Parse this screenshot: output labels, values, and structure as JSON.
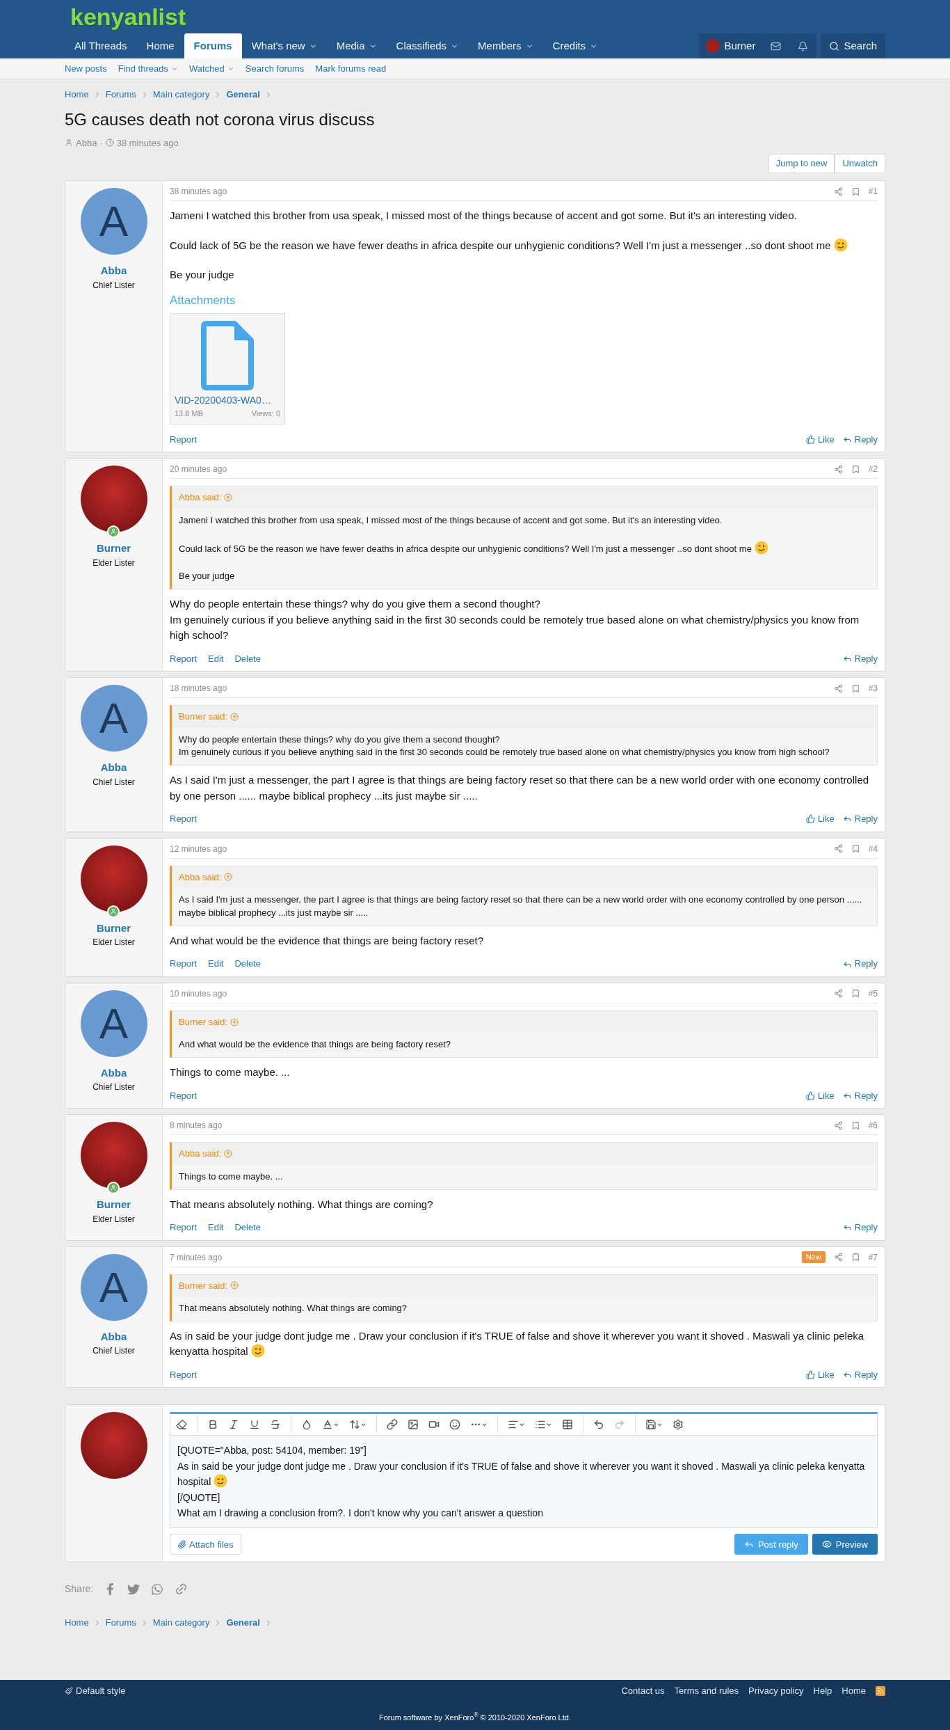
{
  "site": {
    "logo": "kenyanlist"
  },
  "nav": {
    "tabs": [
      {
        "label": "All Threads",
        "selected": false,
        "dropdown": false
      },
      {
        "label": "Home",
        "selected": false,
        "dropdown": false
      },
      {
        "label": "Forums",
        "selected": true,
        "dropdown": false
      },
      {
        "label": "What's new",
        "selected": false,
        "dropdown": true
      },
      {
        "label": "Media",
        "selected": false,
        "dropdown": true
      },
      {
        "label": "Classifieds",
        "selected": false,
        "dropdown": true
      },
      {
        "label": "Members",
        "selected": false,
        "dropdown": true
      },
      {
        "label": "Credits",
        "selected": false,
        "dropdown": true
      }
    ],
    "user": "Burner",
    "search": "Search"
  },
  "subnav": [
    {
      "label": "New posts",
      "dropdown": false
    },
    {
      "label": "Find threads",
      "dropdown": true
    },
    {
      "label": "Watched",
      "dropdown": true
    },
    {
      "label": "Search forums",
      "dropdown": false
    },
    {
      "label": "Mark forums read",
      "dropdown": false
    }
  ],
  "breadcrumb": [
    {
      "label": "Home",
      "current": false
    },
    {
      "label": "Forums",
      "current": false
    },
    {
      "label": "Main category",
      "current": false
    },
    {
      "label": "General",
      "current": true
    }
  ],
  "thread": {
    "title": "5G causes death not corona virus discuss",
    "author": "Abba",
    "separator": "·",
    "time": "38 minutes ago"
  },
  "thread_buttons": [
    "Jump to new",
    "Unwatch"
  ],
  "posts": [
    {
      "time": "38 minutes ago",
      "number": "#1",
      "author": {
        "name": "Abba",
        "title": "Chief Lister",
        "avatar": {
          "kind": "letter",
          "letter": "A"
        }
      },
      "body": {
        "paragraphs": [
          {
            "lines": [
              {
                "text": "Jameni I watched this brother from usa speak, I missed most of the things because of accent and got some. But it's an interesting video.",
                "emoji": false
              }
            ]
          },
          {
            "lines": [
              {
                "text": "Could lack of 5G be the reason we have fewer deaths in africa despite our unhygienic conditions? Well I'm just a messenger ..so dont shoot me",
                "emoji": true
              }
            ]
          },
          {
            "lines": [
              {
                "text": "Be your judge",
                "emoji": false
              }
            ]
          }
        ]
      },
      "attachments_title": "Attachments",
      "attachments": [
        {
          "name": "VID-20200403-WA0…",
          "size": "13.8 MB",
          "views": "Views: 0"
        }
      ],
      "actions": [
        "Report"
      ],
      "like": "Like",
      "reply": "Reply"
    },
    {
      "time": "20 minutes ago",
      "number": "#2",
      "author": {
        "name": "Burner",
        "title": "Elder Lister",
        "avatar": {
          "kind": "photo",
          "online": true
        }
      },
      "quote": {
        "author": "Abba said:",
        "paragraphs": [
          {
            "lines": [
              {
                "text": "Jameni I watched this brother from usa speak, I missed most of the things because of accent and got some. But it's an interesting video.",
                "emoji": false
              }
            ]
          },
          {
            "lines": [
              {
                "text": "Could lack of 5G be the reason we have fewer deaths in africa despite our unhygienic conditions? Well I'm just a messenger ..so dont shoot me",
                "emoji": true
              }
            ]
          },
          {
            "lines": [
              {
                "text": "Be your judge",
                "emoji": false
              }
            ]
          }
        ]
      },
      "body": {
        "paragraphs": [
          {
            "lines": [
              {
                "text": "Why do people entertain these things? why do you give them a second thought?",
                "emoji": false
              },
              {
                "text": "Im genuinely curious if you believe anything said in the first 30 seconds could be remotely true based alone on what chemistry/physics you know from high school?",
                "emoji": false
              }
            ]
          }
        ]
      },
      "actions": [
        "Report",
        "Edit",
        "Delete"
      ],
      "reply": "Reply"
    },
    {
      "time": "18 minutes ago",
      "number": "#3",
      "author": {
        "name": "Abba",
        "title": "Chief Lister",
        "avatar": {
          "kind": "letter",
          "letter": "A"
        }
      },
      "quote": {
        "author": "Burner said:",
        "paragraphs": [
          {
            "lines": [
              {
                "text": "Why do people entertain these things? why do you give them a second thought?",
                "emoji": false
              },
              {
                "text": "Im genuinely curious if you believe anything said in the first 30 seconds could be remotely true based alone on what chemistry/physics you know from high school?",
                "emoji": false
              }
            ]
          }
        ]
      },
      "body": {
        "paragraphs": [
          {
            "lines": [
              {
                "text": "As I said I'm just a messenger, the part I agree is that things are being factory reset so that there can be a new world order with one economy controlled by one person ...... maybe biblical prophecy ...its just maybe sir .....",
                "emoji": false
              }
            ]
          }
        ]
      },
      "actions": [
        "Report"
      ],
      "like": "Like",
      "reply": "Reply"
    },
    {
      "time": "12 minutes ago",
      "number": "#4",
      "author": {
        "name": "Burner",
        "title": "Elder Lister",
        "avatar": {
          "kind": "photo",
          "online": true
        }
      },
      "quote": {
        "author": "Abba said:",
        "paragraphs": [
          {
            "lines": [
              {
                "text": "As I said I'm just a messenger, the part I agree is that things are being factory reset so that there can be a new world order with one economy controlled by one person ...... maybe biblical prophecy ...its just maybe sir .....",
                "emoji": false
              }
            ]
          }
        ]
      },
      "body": {
        "paragraphs": [
          {
            "lines": [
              {
                "text": "And what would be the evidence that things are being factory reset?",
                "emoji": false
              }
            ]
          }
        ]
      },
      "actions": [
        "Report",
        "Edit",
        "Delete"
      ],
      "reply": "Reply"
    },
    {
      "time": "10 minutes ago",
      "number": "#5",
      "author": {
        "name": "Abba",
        "title": "Chief Lister",
        "avatar": {
          "kind": "letter",
          "letter": "A"
        }
      },
      "quote": {
        "author": "Burner said:",
        "paragraphs": [
          {
            "lines": [
              {
                "text": "And what would be the evidence that things are being factory reset?",
                "emoji": false
              }
            ]
          }
        ]
      },
      "body": {
        "paragraphs": [
          {
            "lines": [
              {
                "text": "Things to come maybe. ...",
                "emoji": false
              }
            ]
          }
        ]
      },
      "actions": [
        "Report"
      ],
      "like": "Like",
      "reply": "Reply"
    },
    {
      "time": "8 minutes ago",
      "number": "#6",
      "author": {
        "name": "Burner",
        "title": "Elder Lister",
        "avatar": {
          "kind": "photo",
          "online": true
        }
      },
      "quote": {
        "author": "Abba said:",
        "paragraphs": [
          {
            "lines": [
              {
                "text": "Things to come maybe. ...",
                "emoji": false
              }
            ]
          }
        ]
      },
      "body": {
        "paragraphs": [
          {
            "lines": [
              {
                "text": "That means absolutely nothing. What things are coming?",
                "emoji": false
              }
            ]
          }
        ]
      },
      "actions": [
        "Report",
        "Edit",
        "Delete"
      ],
      "reply": "Reply"
    },
    {
      "time": "7 minutes ago",
      "number": "#7",
      "badge": "New",
      "author": {
        "name": "Abba",
        "title": "Chief Lister",
        "avatar": {
          "kind": "letter",
          "letter": "A"
        }
      },
      "quote": {
        "author": "Burner said:",
        "paragraphs": [
          {
            "lines": [
              {
                "text": "That means absolutely nothing. What things are coming?",
                "emoji": false
              }
            ]
          }
        ]
      },
      "body": {
        "paragraphs": [
          {
            "lines": [
              {
                "text": "As in said be your judge dont judge me . Draw your conclusion if it's TRUE of false and shove it wherever you want it shoved . Maswali ya clinic peleka kenyatta hospital",
                "emoji": true
              }
            ]
          }
        ]
      },
      "actions": [
        "Report"
      ],
      "like": "Like",
      "reply": "Reply"
    }
  ],
  "reply_editor": {
    "lines": [
      {
        "text": "[QUOTE=\"Abba, post: 54104, member: 19\"]",
        "emoji": false
      },
      {
        "text": "As in said be your judge dont judge me . Draw your conclusion if it's TRUE of false and shove it wherever you want it shoved . Maswali ya clinic peleka kenyatta hospital",
        "emoji": true
      },
      {
        "text": "[/QUOTE]",
        "emoji": false
      },
      {
        "text": "What am I drawing a conclusion from?. I don't know why you can't answer a question",
        "emoji": false
      }
    ],
    "attach": "Attach files",
    "buttons": [
      {
        "label": "Post reply",
        "kind": "post"
      },
      {
        "label": "Preview",
        "kind": "preview"
      }
    ]
  },
  "share": "Share:",
  "breadcrumb_bottom": [
    {
      "label": "Home",
      "current": false
    },
    {
      "label": "Forums",
      "current": false
    },
    {
      "label": "Main category",
      "current": false
    },
    {
      "label": "General",
      "current": true
    }
  ],
  "footer": {
    "style": "Default style",
    "links": [
      "Contact us",
      "Terms and rules",
      "Privacy policy",
      "Help",
      "Home"
    ],
    "copyright": "Forum software by XenForo$^{®}$ © 2010-2020 XenForo Ltd."
  }
}
